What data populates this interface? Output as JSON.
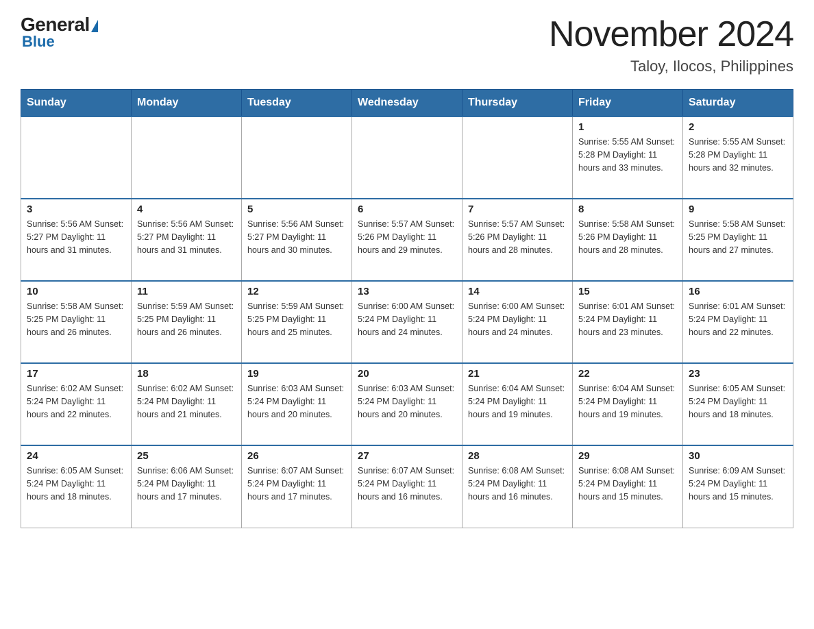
{
  "header": {
    "logo_general": "General",
    "logo_blue": "Blue",
    "month_year": "November 2024",
    "location": "Taloy, Ilocos, Philippines"
  },
  "weekdays": [
    "Sunday",
    "Monday",
    "Tuesday",
    "Wednesday",
    "Thursday",
    "Friday",
    "Saturday"
  ],
  "weeks": [
    [
      {
        "day": "",
        "info": "",
        "empty": true
      },
      {
        "day": "",
        "info": "",
        "empty": true
      },
      {
        "day": "",
        "info": "",
        "empty": true
      },
      {
        "day": "",
        "info": "",
        "empty": true
      },
      {
        "day": "",
        "info": "",
        "empty": true
      },
      {
        "day": "1",
        "info": "Sunrise: 5:55 AM\nSunset: 5:28 PM\nDaylight: 11 hours\nand 33 minutes."
      },
      {
        "day": "2",
        "info": "Sunrise: 5:55 AM\nSunset: 5:28 PM\nDaylight: 11 hours\nand 32 minutes."
      }
    ],
    [
      {
        "day": "3",
        "info": "Sunrise: 5:56 AM\nSunset: 5:27 PM\nDaylight: 11 hours\nand 31 minutes."
      },
      {
        "day": "4",
        "info": "Sunrise: 5:56 AM\nSunset: 5:27 PM\nDaylight: 11 hours\nand 31 minutes."
      },
      {
        "day": "5",
        "info": "Sunrise: 5:56 AM\nSunset: 5:27 PM\nDaylight: 11 hours\nand 30 minutes."
      },
      {
        "day": "6",
        "info": "Sunrise: 5:57 AM\nSunset: 5:26 PM\nDaylight: 11 hours\nand 29 minutes."
      },
      {
        "day": "7",
        "info": "Sunrise: 5:57 AM\nSunset: 5:26 PM\nDaylight: 11 hours\nand 28 minutes."
      },
      {
        "day": "8",
        "info": "Sunrise: 5:58 AM\nSunset: 5:26 PM\nDaylight: 11 hours\nand 28 minutes."
      },
      {
        "day": "9",
        "info": "Sunrise: 5:58 AM\nSunset: 5:25 PM\nDaylight: 11 hours\nand 27 minutes."
      }
    ],
    [
      {
        "day": "10",
        "info": "Sunrise: 5:58 AM\nSunset: 5:25 PM\nDaylight: 11 hours\nand 26 minutes."
      },
      {
        "day": "11",
        "info": "Sunrise: 5:59 AM\nSunset: 5:25 PM\nDaylight: 11 hours\nand 26 minutes."
      },
      {
        "day": "12",
        "info": "Sunrise: 5:59 AM\nSunset: 5:25 PM\nDaylight: 11 hours\nand 25 minutes."
      },
      {
        "day": "13",
        "info": "Sunrise: 6:00 AM\nSunset: 5:24 PM\nDaylight: 11 hours\nand 24 minutes."
      },
      {
        "day": "14",
        "info": "Sunrise: 6:00 AM\nSunset: 5:24 PM\nDaylight: 11 hours\nand 24 minutes."
      },
      {
        "day": "15",
        "info": "Sunrise: 6:01 AM\nSunset: 5:24 PM\nDaylight: 11 hours\nand 23 minutes."
      },
      {
        "day": "16",
        "info": "Sunrise: 6:01 AM\nSunset: 5:24 PM\nDaylight: 11 hours\nand 22 minutes."
      }
    ],
    [
      {
        "day": "17",
        "info": "Sunrise: 6:02 AM\nSunset: 5:24 PM\nDaylight: 11 hours\nand 22 minutes."
      },
      {
        "day": "18",
        "info": "Sunrise: 6:02 AM\nSunset: 5:24 PM\nDaylight: 11 hours\nand 21 minutes."
      },
      {
        "day": "19",
        "info": "Sunrise: 6:03 AM\nSunset: 5:24 PM\nDaylight: 11 hours\nand 20 minutes."
      },
      {
        "day": "20",
        "info": "Sunrise: 6:03 AM\nSunset: 5:24 PM\nDaylight: 11 hours\nand 20 minutes."
      },
      {
        "day": "21",
        "info": "Sunrise: 6:04 AM\nSunset: 5:24 PM\nDaylight: 11 hours\nand 19 minutes."
      },
      {
        "day": "22",
        "info": "Sunrise: 6:04 AM\nSunset: 5:24 PM\nDaylight: 11 hours\nand 19 minutes."
      },
      {
        "day": "23",
        "info": "Sunrise: 6:05 AM\nSunset: 5:24 PM\nDaylight: 11 hours\nand 18 minutes."
      }
    ],
    [
      {
        "day": "24",
        "info": "Sunrise: 6:05 AM\nSunset: 5:24 PM\nDaylight: 11 hours\nand 18 minutes."
      },
      {
        "day": "25",
        "info": "Sunrise: 6:06 AM\nSunset: 5:24 PM\nDaylight: 11 hours\nand 17 minutes."
      },
      {
        "day": "26",
        "info": "Sunrise: 6:07 AM\nSunset: 5:24 PM\nDaylight: 11 hours\nand 17 minutes."
      },
      {
        "day": "27",
        "info": "Sunrise: 6:07 AM\nSunset: 5:24 PM\nDaylight: 11 hours\nand 16 minutes."
      },
      {
        "day": "28",
        "info": "Sunrise: 6:08 AM\nSunset: 5:24 PM\nDaylight: 11 hours\nand 16 minutes."
      },
      {
        "day": "29",
        "info": "Sunrise: 6:08 AM\nSunset: 5:24 PM\nDaylight: 11 hours\nand 15 minutes."
      },
      {
        "day": "30",
        "info": "Sunrise: 6:09 AM\nSunset: 5:24 PM\nDaylight: 11 hours\nand 15 minutes."
      }
    ]
  ]
}
